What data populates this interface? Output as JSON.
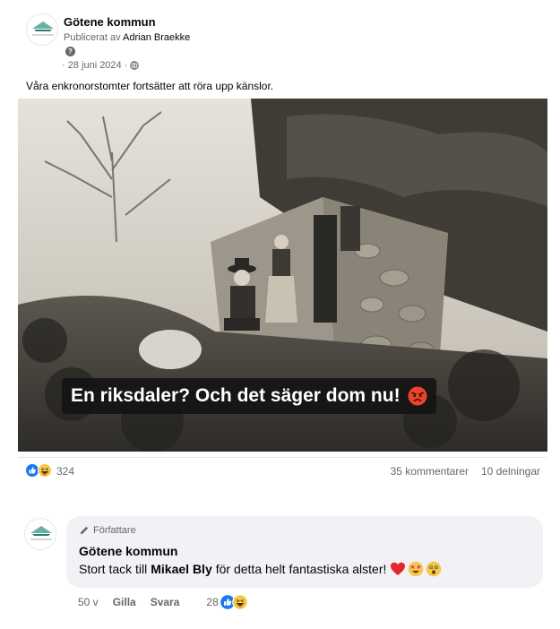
{
  "post": {
    "page_name": "Götene kommun",
    "byline_prefix": "Publicerat av",
    "author": "Adrian Braekke",
    "help_glyph": "?",
    "date": "· 28 juni 2024 ·",
    "caption": "Våra enkronorstomter fortsätter att röra upp känslor.",
    "image_overlay_text": "En riksdaler? Och det säger dom nu!",
    "logo_text": "Götene kommun"
  },
  "stats": {
    "reaction_count": "324",
    "comments": "35 kommentarer",
    "shares": "10 delningar",
    "reactions": [
      "like-icon",
      "haha-icon"
    ]
  },
  "comment": {
    "badge": "Författare",
    "name": "Götene kommun",
    "text_before": "Stort tack till",
    "mention": "Mikael Bly",
    "text_after": "för detta helt fantastiska alster!",
    "emojis": [
      "red-heart-icon",
      "star-struck-icon",
      "astonished-icon"
    ],
    "time": "50 v",
    "like_label": "Gilla",
    "reply_label": "Svara",
    "reaction_count": "28"
  },
  "colors": {
    "secondary_text": "#65676b",
    "like_blue": "#1877f2",
    "bubble_bg": "#f0f2f5"
  }
}
